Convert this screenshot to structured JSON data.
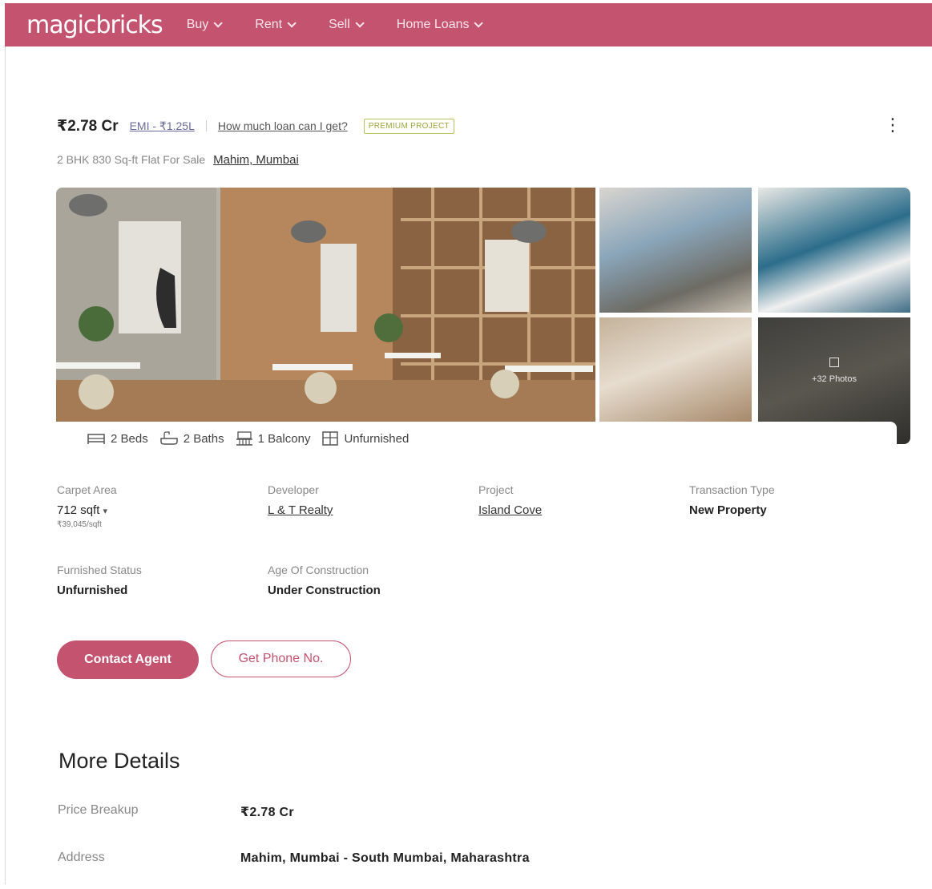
{
  "header": {
    "logo": "magicbricks",
    "nav": [
      "Buy",
      "Rent",
      "Sell",
      "Home Loans"
    ],
    "brand_color": "#c4536f"
  },
  "listing": {
    "price": "₹2.78 Cr",
    "emi": "EMI - ₹1.25L",
    "loan_link": "How much loan can I get?",
    "badge": "PREMIUM PROJECT",
    "subtitle": "2 BHK 830 Sq-ft Flat For Sale",
    "location": "Mahim, Mumbai"
  },
  "gallery": {
    "photos_count": "+32 Photos"
  },
  "specs": {
    "beds": "2 Beds",
    "baths": "2 Baths",
    "balcony": "1 Balcony",
    "furnishing": "Unfurnished"
  },
  "details": {
    "carpet_area_label": "Carpet Area",
    "carpet_area_value": "712 sqft",
    "price_per_sqft": "₹39,045/sqft",
    "developer_label": "Developer",
    "developer_value": "L & T Realty",
    "project_label": "Project",
    "project_value": "Island Cove",
    "transaction_label": "Transaction Type",
    "transaction_value": "New Property",
    "furnished_label": "Furnished Status",
    "furnished_value": "Unfurnished",
    "age_label": "Age Of Construction",
    "age_value": "Under Construction"
  },
  "actions": {
    "contact_agent": "Contact Agent",
    "get_phone": "Get Phone No."
  },
  "more_details": {
    "title": "More Details",
    "price_breakup_label": "Price Breakup",
    "price_breakup_value": "₹2.78 Cr",
    "address_label": "Address",
    "address_value": "Mahim, Mumbai - South Mumbai, Maharashtra"
  }
}
